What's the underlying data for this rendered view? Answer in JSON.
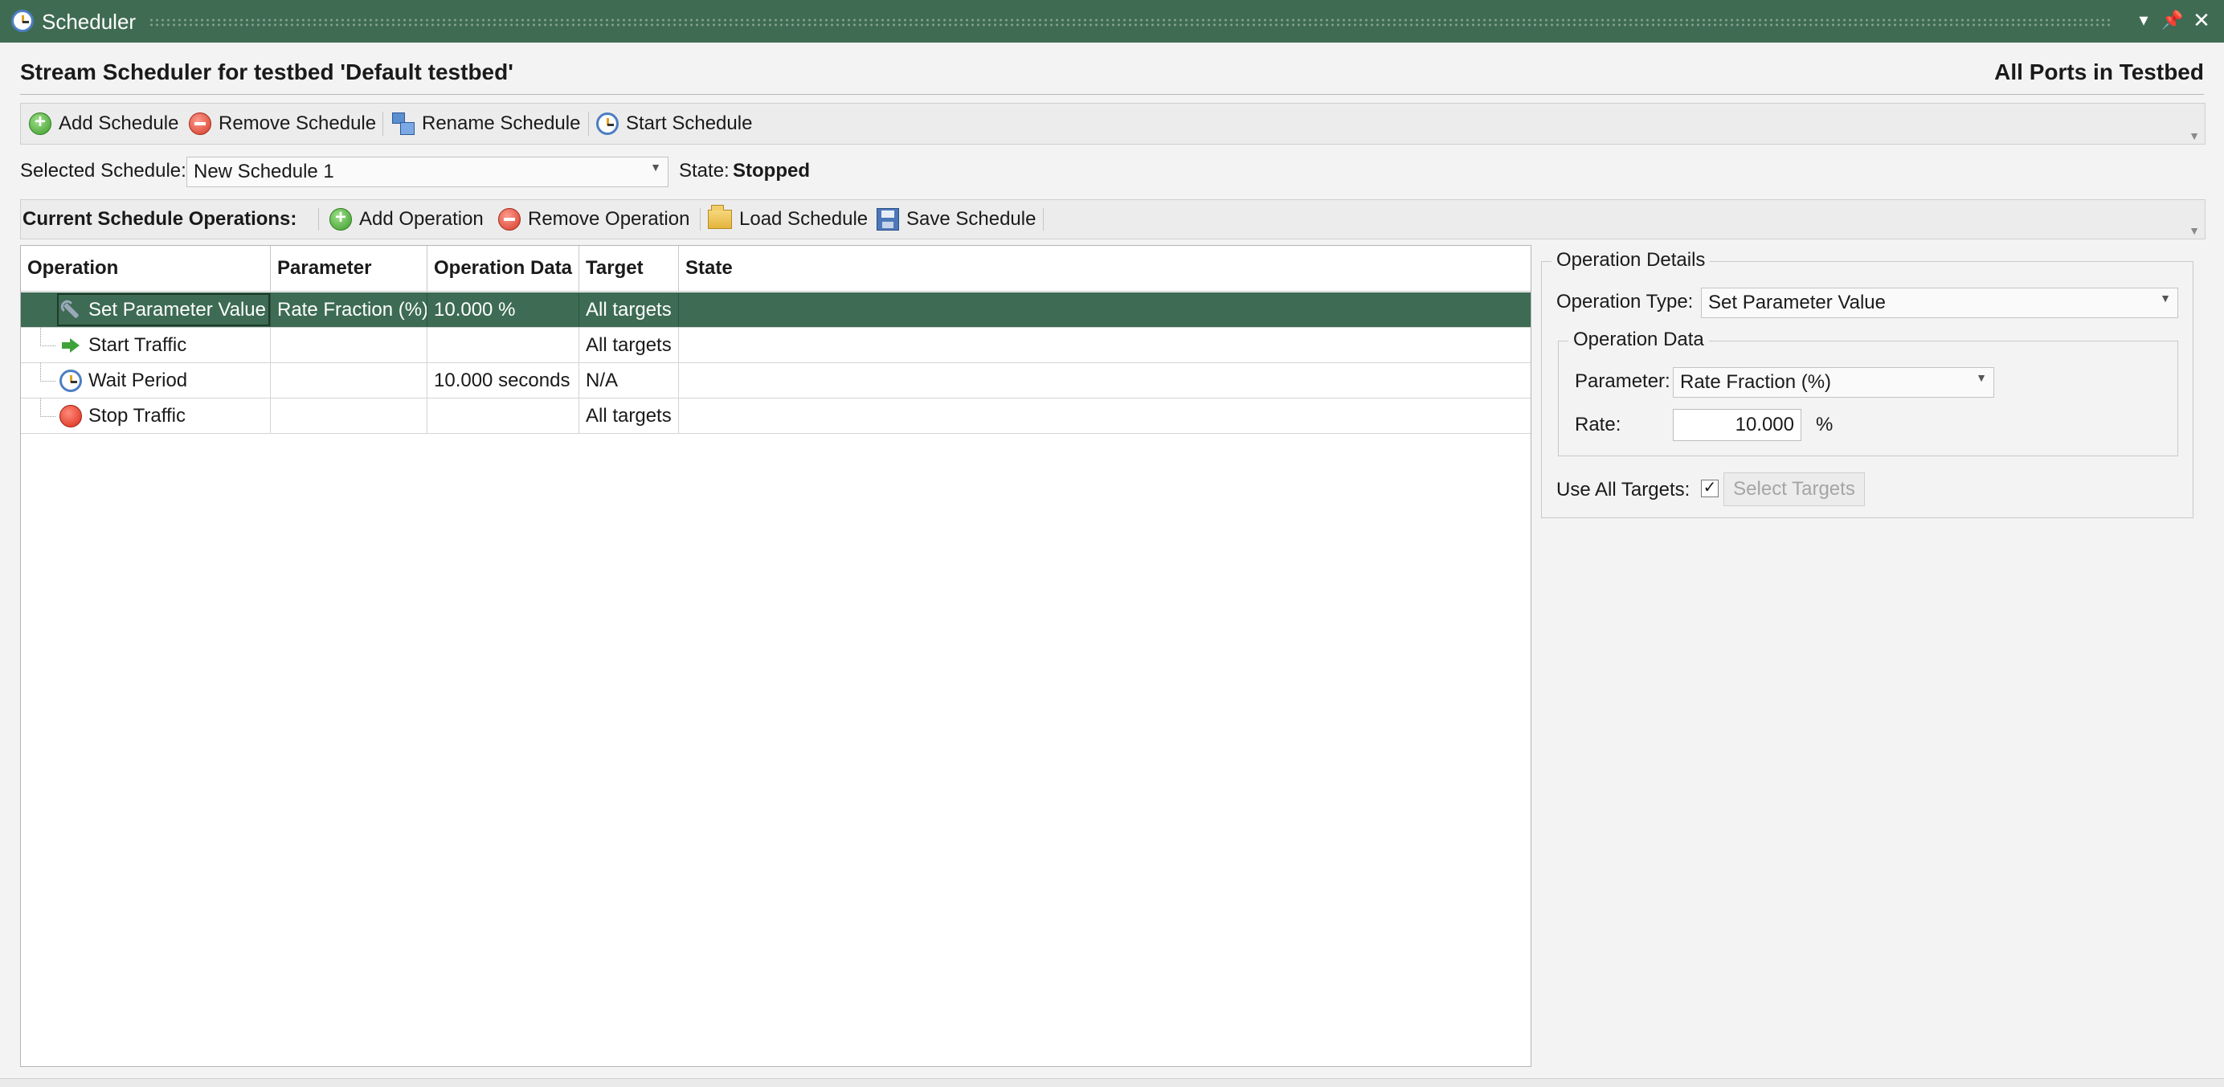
{
  "window": {
    "title": "Scheduler",
    "icon": "alarm-clock-icon",
    "controls": [
      "chevron-down-icon",
      "pin-icon",
      "close-icon"
    ]
  },
  "header": {
    "title": "Stream Scheduler for testbed 'Default testbed'",
    "scope": "All Ports in Testbed"
  },
  "schedule_toolbar": {
    "add": "Add Schedule",
    "remove": "Remove Schedule",
    "rename": "Rename Schedule",
    "start": "Start Schedule"
  },
  "selection": {
    "schedule_label": "Selected Schedule:",
    "schedule_value": "New Schedule 1",
    "state_label": "State:",
    "state_value": "Stopped"
  },
  "operations_toolbar": {
    "label": "Current Schedule Operations:",
    "add": "Add Operation",
    "remove": "Remove Operation",
    "load": "Load Schedule",
    "save": "Save Schedule"
  },
  "grid": {
    "columns": [
      "Operation",
      "Parameter",
      "Operation Data",
      "Target",
      "State"
    ],
    "rows": [
      {
        "icon": "wrench-icon",
        "operation": "Set Parameter Value",
        "parameter": "Rate Fraction (%)",
        "data": "10.000 %",
        "target": "All targets",
        "state": "",
        "selected": true
      },
      {
        "icon": "arrow-right-icon",
        "operation": "Start Traffic",
        "parameter": "",
        "data": "",
        "target": "All targets",
        "state": ""
      },
      {
        "icon": "alarm-clock-icon",
        "operation": "Wait Period",
        "parameter": "",
        "data": "10.000 seconds",
        "target": "N/A",
        "state": ""
      },
      {
        "icon": "stop-icon",
        "operation": "Stop Traffic",
        "parameter": "",
        "data": "",
        "target": "All targets",
        "state": ""
      }
    ]
  },
  "details": {
    "group_title": "Operation Details",
    "type_label": "Operation Type:",
    "type_value": "Set Parameter Value",
    "data_group_title": "Operation Data",
    "parameter_label": "Parameter:",
    "parameter_value": "Rate Fraction (%)",
    "rate_label": "Rate:",
    "rate_value": "10.000",
    "rate_unit": "%",
    "use_all_label": "Use All Targets:",
    "use_all_checked": true,
    "select_targets": "Select Targets"
  },
  "colors": {
    "titlebar": "#3f6b52",
    "selected_row": "#3d6b53"
  }
}
